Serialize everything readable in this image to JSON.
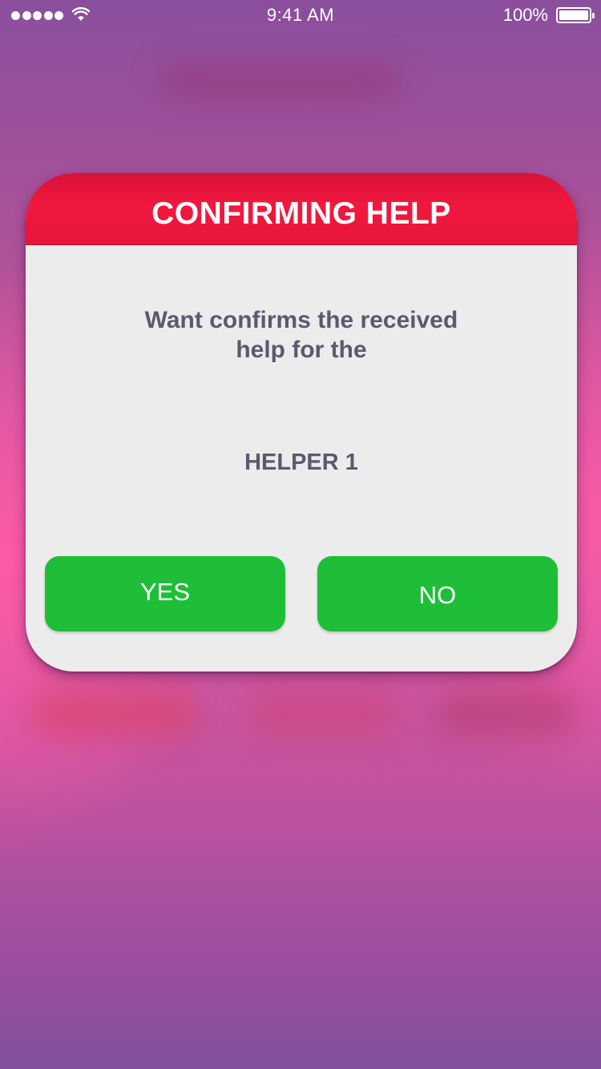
{
  "status_bar": {
    "time": "9:41 AM",
    "battery": "100%",
    "signal_icon": "signal-dots-icon",
    "wifi_icon": "wifi-icon",
    "battery_icon": "battery-icon"
  },
  "dialog": {
    "title": "CONFIRMING HELP",
    "message_line1": "Want confirms the received",
    "message_line2": "help for the",
    "helper_name": "HELPER 1",
    "yes_label": "YES",
    "no_label": "NO"
  },
  "colors": {
    "header_red": "#ee173d",
    "button_green": "#1fbe38",
    "text_gray": "#5a5a6e",
    "dialog_bg": "#ececec"
  }
}
